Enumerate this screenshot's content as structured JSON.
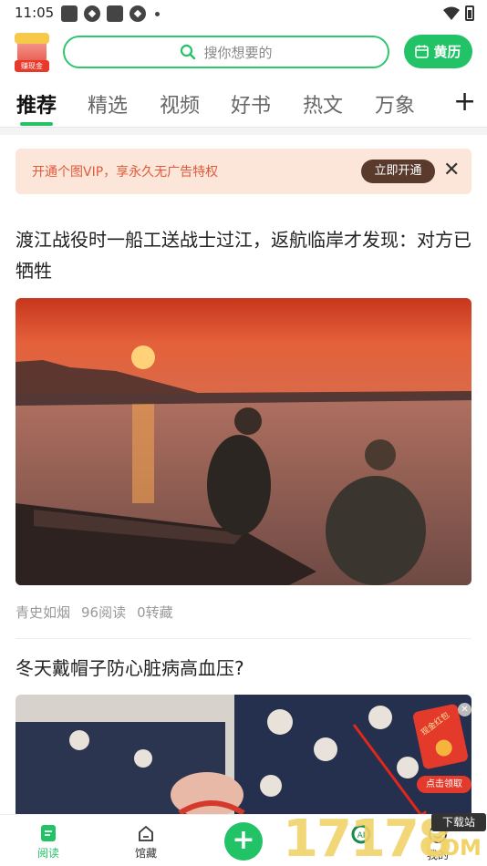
{
  "status_bar": {
    "time": "11:05"
  },
  "header": {
    "earn_label": "赚现金",
    "search_placeholder": "搜你想要的",
    "calendar_label": "黄历"
  },
  "tabs": [
    "推荐",
    "精选",
    "视频",
    "好书",
    "热文",
    "万象"
  ],
  "vip_banner": {
    "text": "开通个图VIP，享永久无广告特权",
    "button": "立即开通"
  },
  "articles": [
    {
      "title": "渡江战役时一船工送战士过江，返航临岸才发现：对方已牺牲",
      "author": "青史如烟",
      "reads": "96阅读",
      "saves": "0转藏"
    },
    {
      "title": "冬天戴帽子防心脏病高血压?"
    }
  ],
  "red_packet": {
    "label": "现金红包",
    "cta": "点击领取"
  },
  "bottom_nav": {
    "read": "阅读",
    "collection": "馆藏",
    "mine": "我的"
  },
  "watermark": {
    "digits": "17178",
    "site": "下载站",
    "com": "COM"
  },
  "colors": {
    "accent": "#22c267",
    "vip_bg": "#fbe6d9",
    "vip_text": "#e05a3a",
    "vip_button": "#5a3a2c",
    "packet_red": "#e33a2c"
  }
}
